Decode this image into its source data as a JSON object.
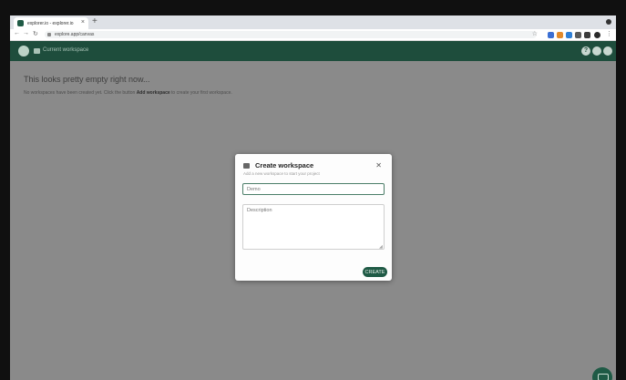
{
  "browser": {
    "tab_title": "explorer.io - explorer.io",
    "url": "explore.app/canvas"
  },
  "app": {
    "breadcrumb": "Current workspace"
  },
  "empty_state": {
    "title": "This looks pretty empty right now...",
    "desc_before": "No workspaces have been created yet. Click the button",
    "desc_bold": "Add workspace",
    "desc_after": "to create your first workspace."
  },
  "modal": {
    "title": "Create workspace",
    "subtitle": "Add a new workspace to start your project",
    "name_placeholder": "Demo",
    "description_placeholder": "Description",
    "create_label": "CREATE"
  },
  "colors": {
    "brand": "#1e4d3c",
    "overlay": "#8a8a8a",
    "button": "#1f5a45"
  }
}
